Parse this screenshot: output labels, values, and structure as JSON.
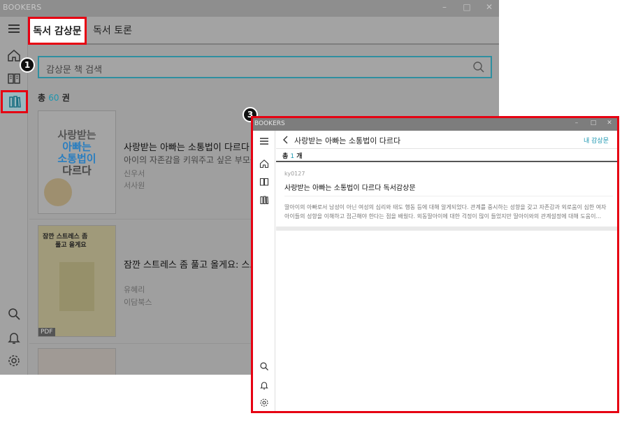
{
  "background_window": {
    "app_title": "BOOKERS",
    "window_controls": [
      "–",
      "□",
      "✕"
    ],
    "tabs": [
      {
        "label": "독서 감상문",
        "active": true
      },
      {
        "label": "독서 토론",
        "active": false
      }
    ],
    "search": {
      "placeholder": "감상문 책 검색"
    },
    "total": {
      "prefix": "총",
      "count": "60",
      "suffix": "권"
    },
    "books": [
      {
        "cover_text": [
          "사랑받는",
          "아빠는",
          "소통법이",
          "다르다"
        ],
        "title": "사랑받는 아빠는 소통법이 다르다",
        "subtitle": "아이의 자존감을 키워주고 싶은 부모를",
        "author": "신우서",
        "publisher": "서사원"
      },
      {
        "cover_text": [
          "잠깐 스트레스 좀",
          "풀고 올게요"
        ],
        "title": "잠깐 스트레스 좀 풀고 올게요: 스트레",
        "subtitle": "",
        "author": "유혜리",
        "publisher": "이담북스",
        "badge": "PDF"
      }
    ]
  },
  "foreground_window": {
    "app_title": "BOOKERS",
    "window_controls": [
      "–",
      "□",
      "✕"
    ],
    "header": {
      "title": "사랑받는 아빠는 소통법이 다르다",
      "link": "내 감상문"
    },
    "total": {
      "prefix": "총",
      "count": "1",
      "suffix": "개"
    },
    "review": {
      "user": "ky0127",
      "title": "사랑받는 아빠는 소통법이 다르다 독서감상문",
      "body_line1": "딸아이의 아빠로서 남성이 아닌 여성의 심리와 태도 행동 등에 대해 알게되었다. 관계를 중시하는 성향을 갖고 자존감과 외로움이 심한 여자",
      "body_line2": "아이들의 성향을 이해하고 접근해야 한다는 점을 배웠다. 외동딸아이에 대한 걱정이 많이 들었지만 딸아이와의 관계설정에 대해 도움이..."
    }
  },
  "markers": {
    "first": "1",
    "third": "3"
  },
  "colors": {
    "accent": "#1b96b0",
    "highlight_red": "#e60012",
    "overlay_gray": "#9f9f9f"
  },
  "icons": {
    "sidebar": [
      "home-icon",
      "book-icon",
      "bookshelf-icon",
      "search-icon",
      "bell-icon",
      "gear-icon"
    ],
    "header": [
      "menu-icon",
      "back-icon",
      "search-icon"
    ]
  }
}
